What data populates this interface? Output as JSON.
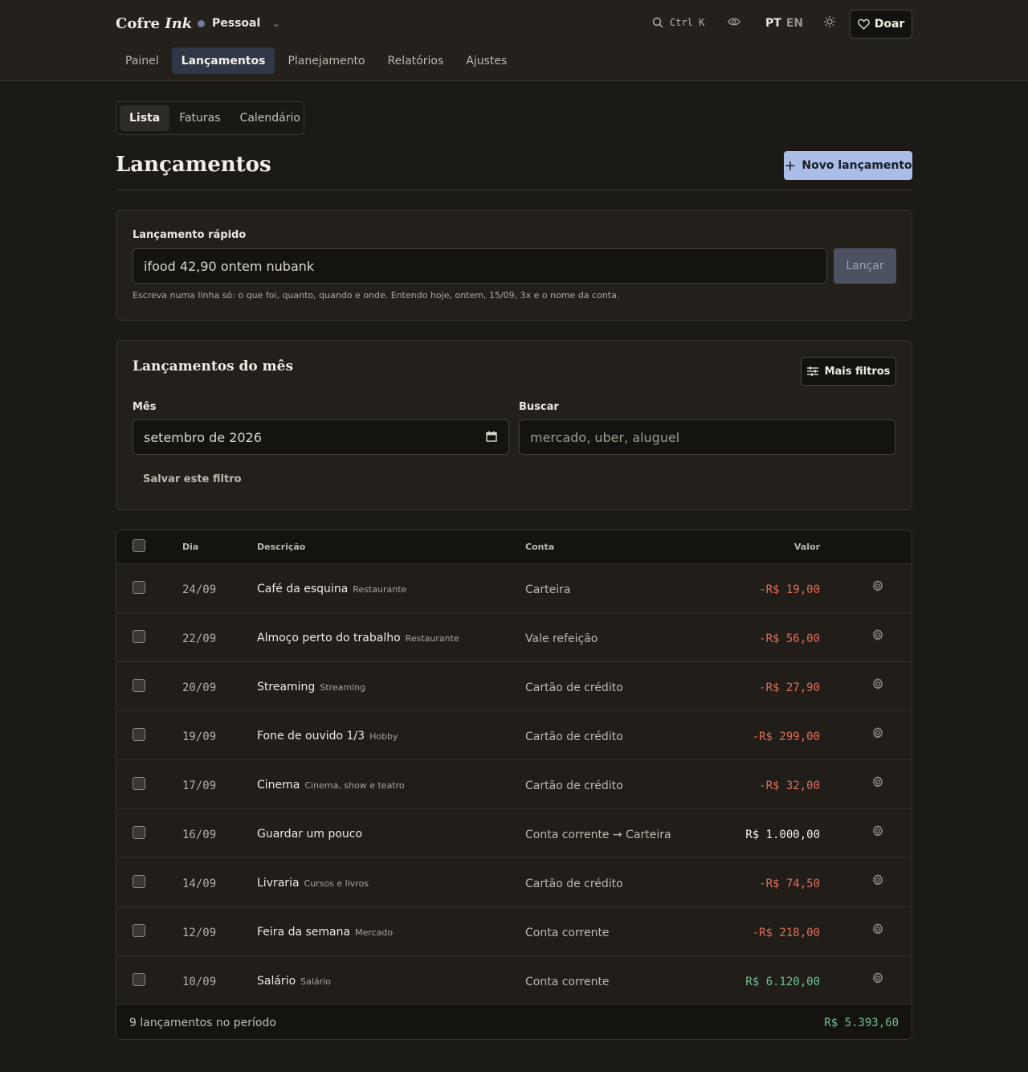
{
  "brand": {
    "name": "Cofre",
    "name_italic": "Ink"
  },
  "workspace": {
    "label": "Pessoal"
  },
  "search": {
    "shortcut": "Ctrl K"
  },
  "lang": {
    "active": "PT",
    "other": "EN"
  },
  "donate": {
    "label": "Doar"
  },
  "nav": [
    {
      "label": "Painel"
    },
    {
      "label": "Lançamentos"
    },
    {
      "label": "Planejamento"
    },
    {
      "label": "Relatórios"
    },
    {
      "label": "Ajustes"
    }
  ],
  "subtabs": [
    {
      "label": "Lista"
    },
    {
      "label": "Faturas"
    },
    {
      "label": "Calendário"
    }
  ],
  "page": {
    "title": "Lançamentos",
    "new_button": "Novo lançamento"
  },
  "quick": {
    "label": "Lançamento rápido",
    "value": "ifood 42,90 ontem nubank",
    "button": "Lançar",
    "hint": "Escreva numa linha só: o que foi, quanto, quando e onde. Entendo hoje, ontem, 15/09, 3x e o nome da conta."
  },
  "month_filter": {
    "title": "Lançamentos do mês",
    "more_filters": "Mais filtros",
    "month_label": "Mês",
    "month_value": "setembro de 2026",
    "search_label": "Buscar",
    "search_placeholder": "mercado, uber, aluguel",
    "save_filter": "Salvar este filtro"
  },
  "table": {
    "headers": {
      "day": "Dia",
      "description": "Descrição",
      "account": "Conta",
      "value": "Valor"
    },
    "rows": [
      {
        "day": "24/09",
        "desc": "Café da esquina",
        "cat": "Restaurante",
        "account": "Carteira",
        "value": "-R$ 19,00",
        "kind": "neg"
      },
      {
        "day": "22/09",
        "desc": "Almoço perto do trabalho",
        "cat": "Restaurante",
        "account": "Vale refeição",
        "value": "-R$ 56,00",
        "kind": "neg"
      },
      {
        "day": "20/09",
        "desc": "Streaming",
        "cat": "Streaming",
        "account": "Cartão de crédito",
        "value": "-R$ 27,90",
        "kind": "neg"
      },
      {
        "day": "19/09",
        "desc": "Fone de ouvido 1/3",
        "cat": "Hobby",
        "account": "Cartão de crédito",
        "value": "-R$ 299,00",
        "kind": "neg"
      },
      {
        "day": "17/09",
        "desc": "Cinema",
        "cat": "Cinema, show e teatro",
        "account": "Cartão de crédito",
        "value": "-R$ 32,00",
        "kind": "neg"
      },
      {
        "day": "16/09",
        "desc": "Guardar um pouco",
        "cat": "",
        "account": "Conta corrente → Carteira",
        "value": "R$ 1.000,00",
        "kind": "neu"
      },
      {
        "day": "14/09",
        "desc": "Livraria",
        "cat": "Cursos e livros",
        "account": "Cartão de crédito",
        "value": "-R$ 74,50",
        "kind": "neg"
      },
      {
        "day": "12/09",
        "desc": "Feira da semana",
        "cat": "Mercado",
        "account": "Conta corrente",
        "value": "-R$ 218,00",
        "kind": "neg"
      },
      {
        "day": "10/09",
        "desc": "Salário",
        "cat": "Salário",
        "account": "Conta corrente",
        "value": "R$ 6.120,00",
        "kind": "pos"
      }
    ],
    "footer": {
      "count": "9 lançamentos no período",
      "total": "R$ 5.393,60"
    }
  },
  "colors": {
    "accent": "#a9bde6",
    "negative": "#e06c57",
    "positive": "#6fc28e"
  }
}
